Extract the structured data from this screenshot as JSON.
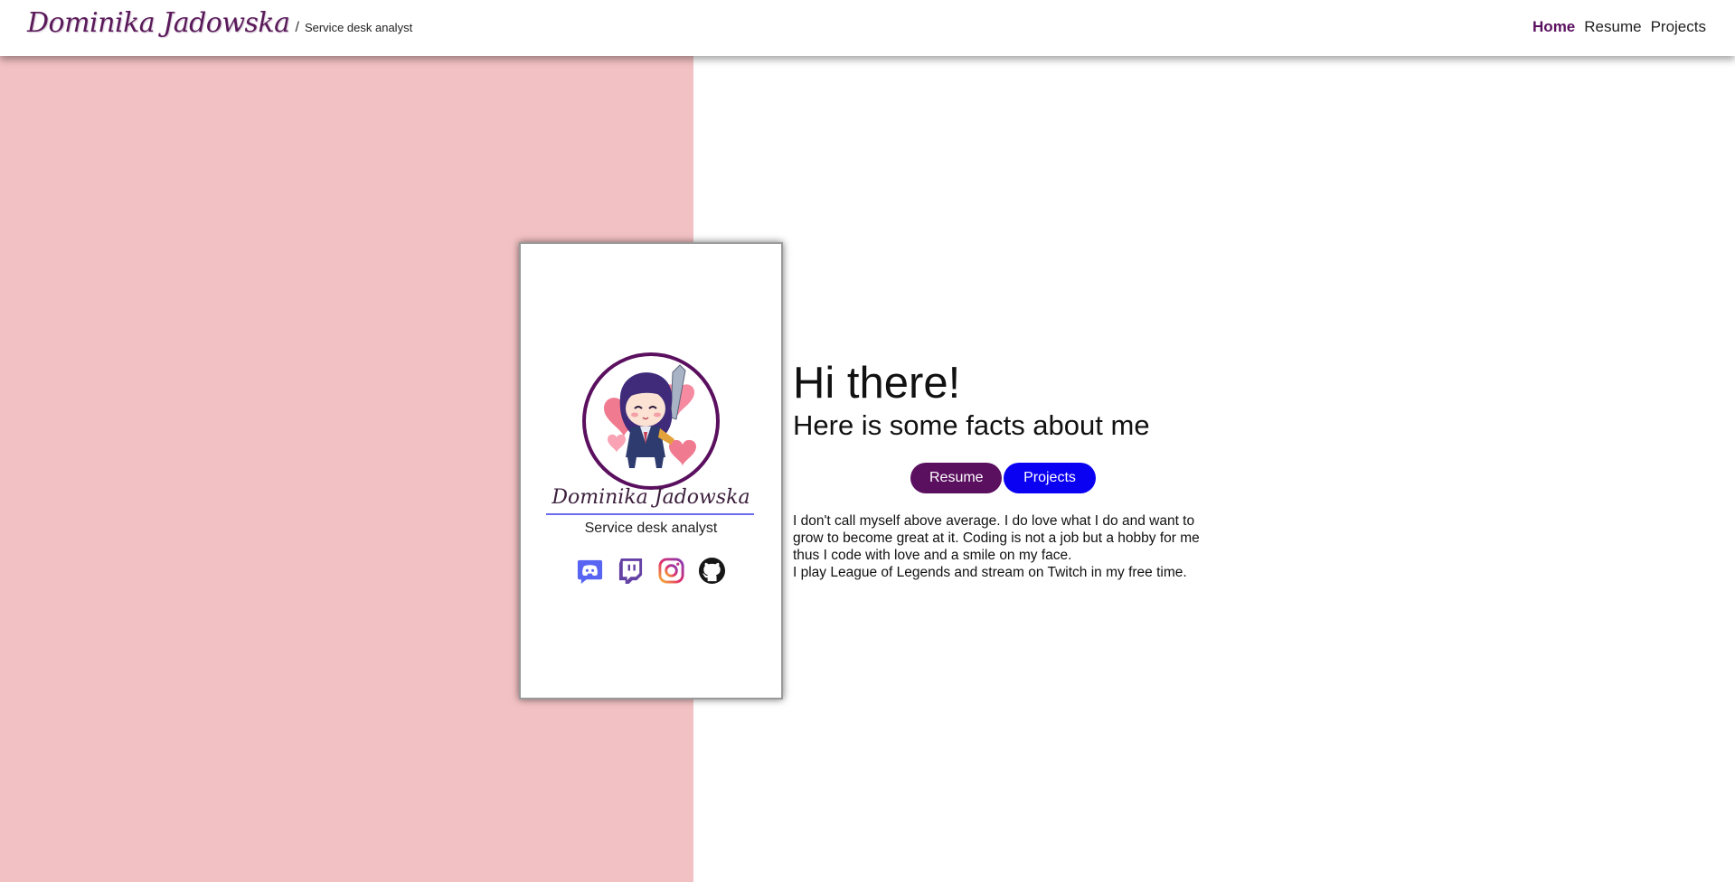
{
  "navbar": {
    "brand_name": "Dominika Jadowska",
    "brand_separator": "/",
    "brand_subtitle": "Service desk analyst",
    "links": [
      {
        "label": "Home",
        "active": true
      },
      {
        "label": "Resume",
        "active": false
      },
      {
        "label": "Projects",
        "active": false
      }
    ]
  },
  "card": {
    "avatar_icon": "chibi-character-avatar",
    "name": "Dominika Jadowska",
    "role": "Service desk analyst",
    "socials": [
      {
        "icon": "discord-icon",
        "color": "#5865F2"
      },
      {
        "icon": "twitch-icon",
        "color": "#6441A5"
      },
      {
        "icon": "instagram-icon",
        "color": "#E1306C"
      },
      {
        "icon": "github-icon",
        "color": "#181717"
      }
    ]
  },
  "hero": {
    "title": "Hi there!",
    "subtitle": "Here is some facts about me",
    "buttons": {
      "resume_label": "Resume",
      "projects_label": "Projects"
    },
    "about_line1": "I don't call myself above average. I do love what I do and want to grow to become great at it. Coding is not a job but a hobby for me thus I code with love and a smile on my face.",
    "about_line2": "I play League of Legends and stream on Twitch in my free time."
  },
  "colors": {
    "accent_purple": "#5a0f5f",
    "accent_blue": "#0a00f2",
    "panel_pink": "#f2c1c3"
  }
}
